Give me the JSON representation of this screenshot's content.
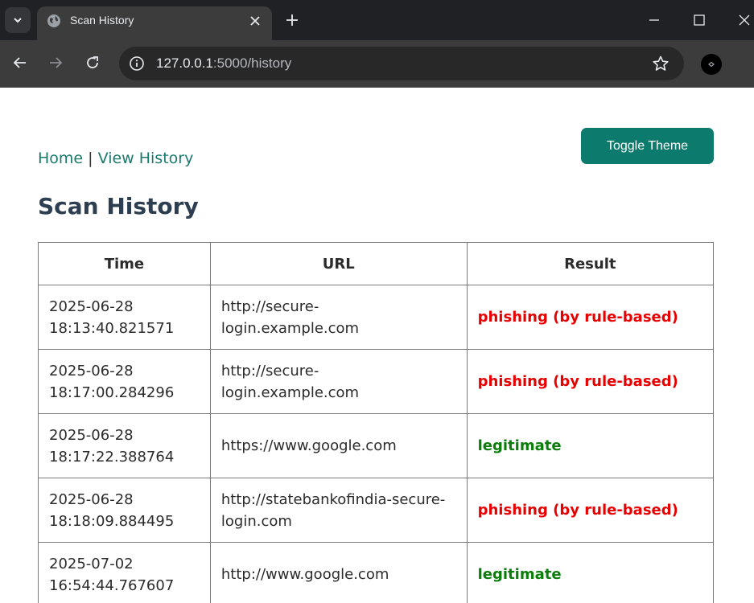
{
  "browser": {
    "tab_title": "Scan History",
    "url_host": "127.0.0.1",
    "url_path": ":5000/history",
    "icons": [
      "tab-search-icon",
      "globe-icon",
      "close-icon",
      "plus-icon",
      "minimize-icon",
      "maximize-icon",
      "window-close-icon",
      "back-icon",
      "forward-icon",
      "reload-icon",
      "info-icon",
      "star-icon",
      "profile-icon"
    ]
  },
  "nav": {
    "home_label": "Home",
    "separator": "|",
    "history_label": "View History"
  },
  "theme_button_label": "Toggle Theme",
  "page_title": "Scan History",
  "table": {
    "headers": [
      "Time",
      "URL",
      "Result"
    ],
    "rows": [
      {
        "time_date": "2025-06-28",
        "time_clock": "18:13:40.821571",
        "url_line1": "http://secure-login.example.com",
        "url_line2": "",
        "result": "phishing (by rule-based)",
        "status": "phishing"
      },
      {
        "time_date": "2025-06-28",
        "time_clock": "18:17:00.284296",
        "url_line1": "http://secure-login.example.com",
        "url_line2": "",
        "result": "phishing (by rule-based)",
        "status": "phishing"
      },
      {
        "time_date": "2025-06-28",
        "time_clock": "18:17:22.388764",
        "url_line1": "https://www.google.com",
        "url_line2": "",
        "result": "legitimate",
        "status": "legitimate"
      },
      {
        "time_date": "2025-06-28",
        "time_clock": "18:18:09.884495",
        "url_line1": "http://statebankofindia-secure-",
        "url_line2": "login.com",
        "result": "phishing (by rule-based)",
        "status": "phishing"
      },
      {
        "time_date": "2025-07-02",
        "time_clock": "16:54:44.767607",
        "url_line1": "http://www.google.com",
        "url_line2": "",
        "result": "legitimate",
        "status": "legitimate"
      }
    ]
  },
  "colors": {
    "phishing": "#e60000",
    "legitimate": "#0a7d0a",
    "accent": "#0c7a6c",
    "link": "#1b7a6e",
    "title": "#2c3e50"
  }
}
